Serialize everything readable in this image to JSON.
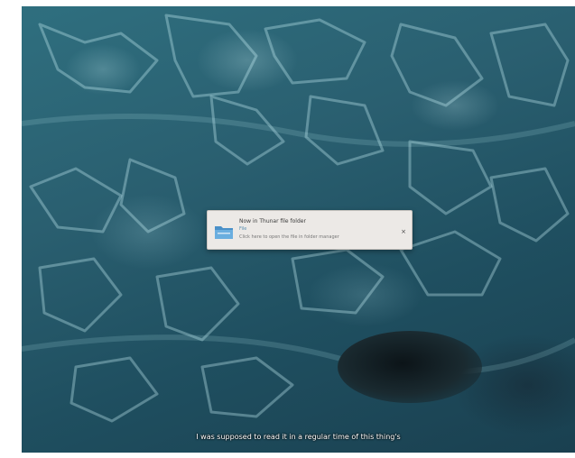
{
  "notification": {
    "title": "Now in Thunar file folder",
    "subtitle": "File",
    "detail": "Click here to open the file in folder manager",
    "icon": "folder-icon",
    "close_icon": "close-icon"
  },
  "subtitle": {
    "text": "I was supposed to read it in a regular time of this thing's"
  },
  "colors": {
    "water_dark": "#1a4050",
    "water_light": "#2f6f7f",
    "notification_bg": "#ece9e6",
    "folder_blue": "#4a90c8"
  }
}
